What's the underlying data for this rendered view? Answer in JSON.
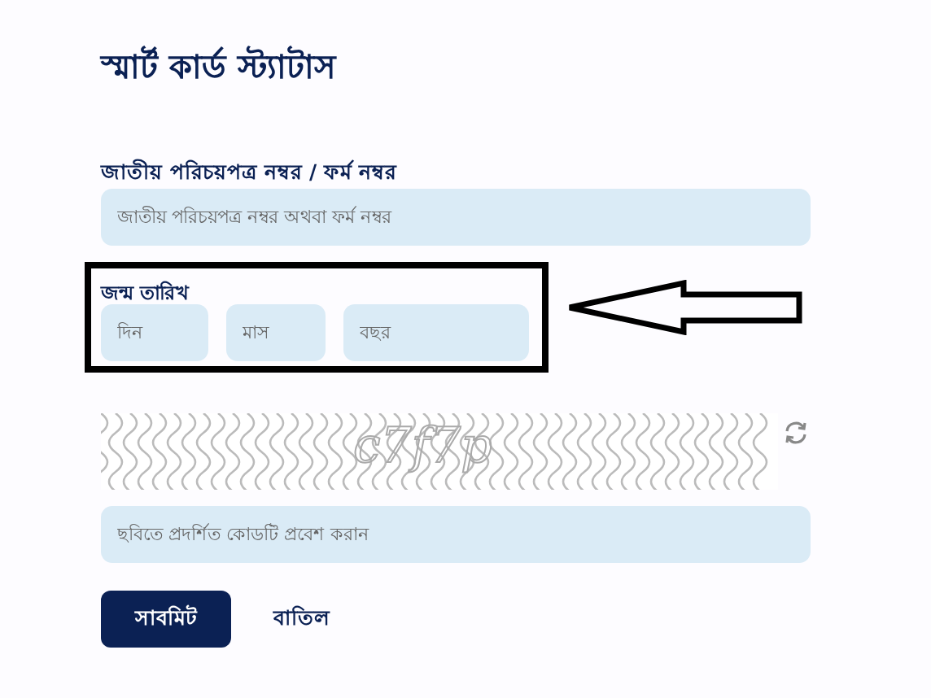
{
  "title": "স্মার্ট কার্ড স্ট্যাটাস",
  "id_field": {
    "label": "জাতীয় পরিচয়পত্র নম্বর / ফর্ম নম্বর",
    "placeholder": "জাতীয় পরিচয়পত্র নম্বর অথবা ফর্ম নম্বর"
  },
  "birth_date": {
    "label": "জন্ম তারিখ",
    "fields": [
      {
        "placeholder": "দিন",
        "kind": "day"
      },
      {
        "placeholder": "মাস",
        "kind": "month"
      },
      {
        "placeholder": "বছর",
        "kind": "year"
      }
    ]
  },
  "captcha": {
    "code": "c7f7p"
  },
  "captcha_field": {
    "placeholder": "ছবিতে প্রদর্শিত কোডটি প্রবেশ করান"
  },
  "buttons": [
    {
      "label": "সাবমিট",
      "kind": "primary"
    },
    {
      "label": "বাতিল",
      "kind": "link"
    }
  ]
}
